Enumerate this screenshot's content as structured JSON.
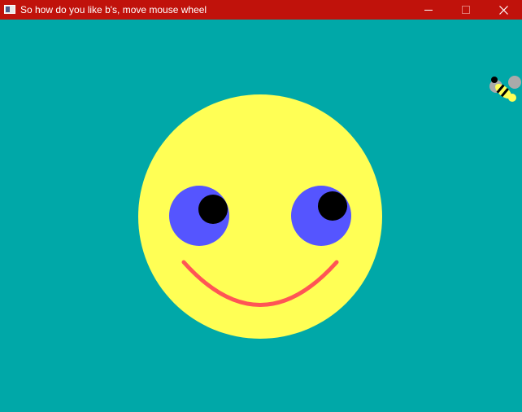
{
  "window": {
    "title": "So how do you like b's, move mouse wheel",
    "titlebar_color": "#c0120b",
    "background_color": "#00a8a8",
    "controls": {
      "minimize_icon": "minimize-icon",
      "maximize_icon": "maximize-icon",
      "close_icon": "close-icon"
    }
  },
  "scene": {
    "face_color": "#ffff55",
    "eye_color": "#5555ff",
    "pupil_color": "#000000",
    "mouth_color": "#ff5555",
    "bee_colors": {
      "body": "#ffff55",
      "stripes": "#000000",
      "wings": "#aaaaaa"
    }
  }
}
